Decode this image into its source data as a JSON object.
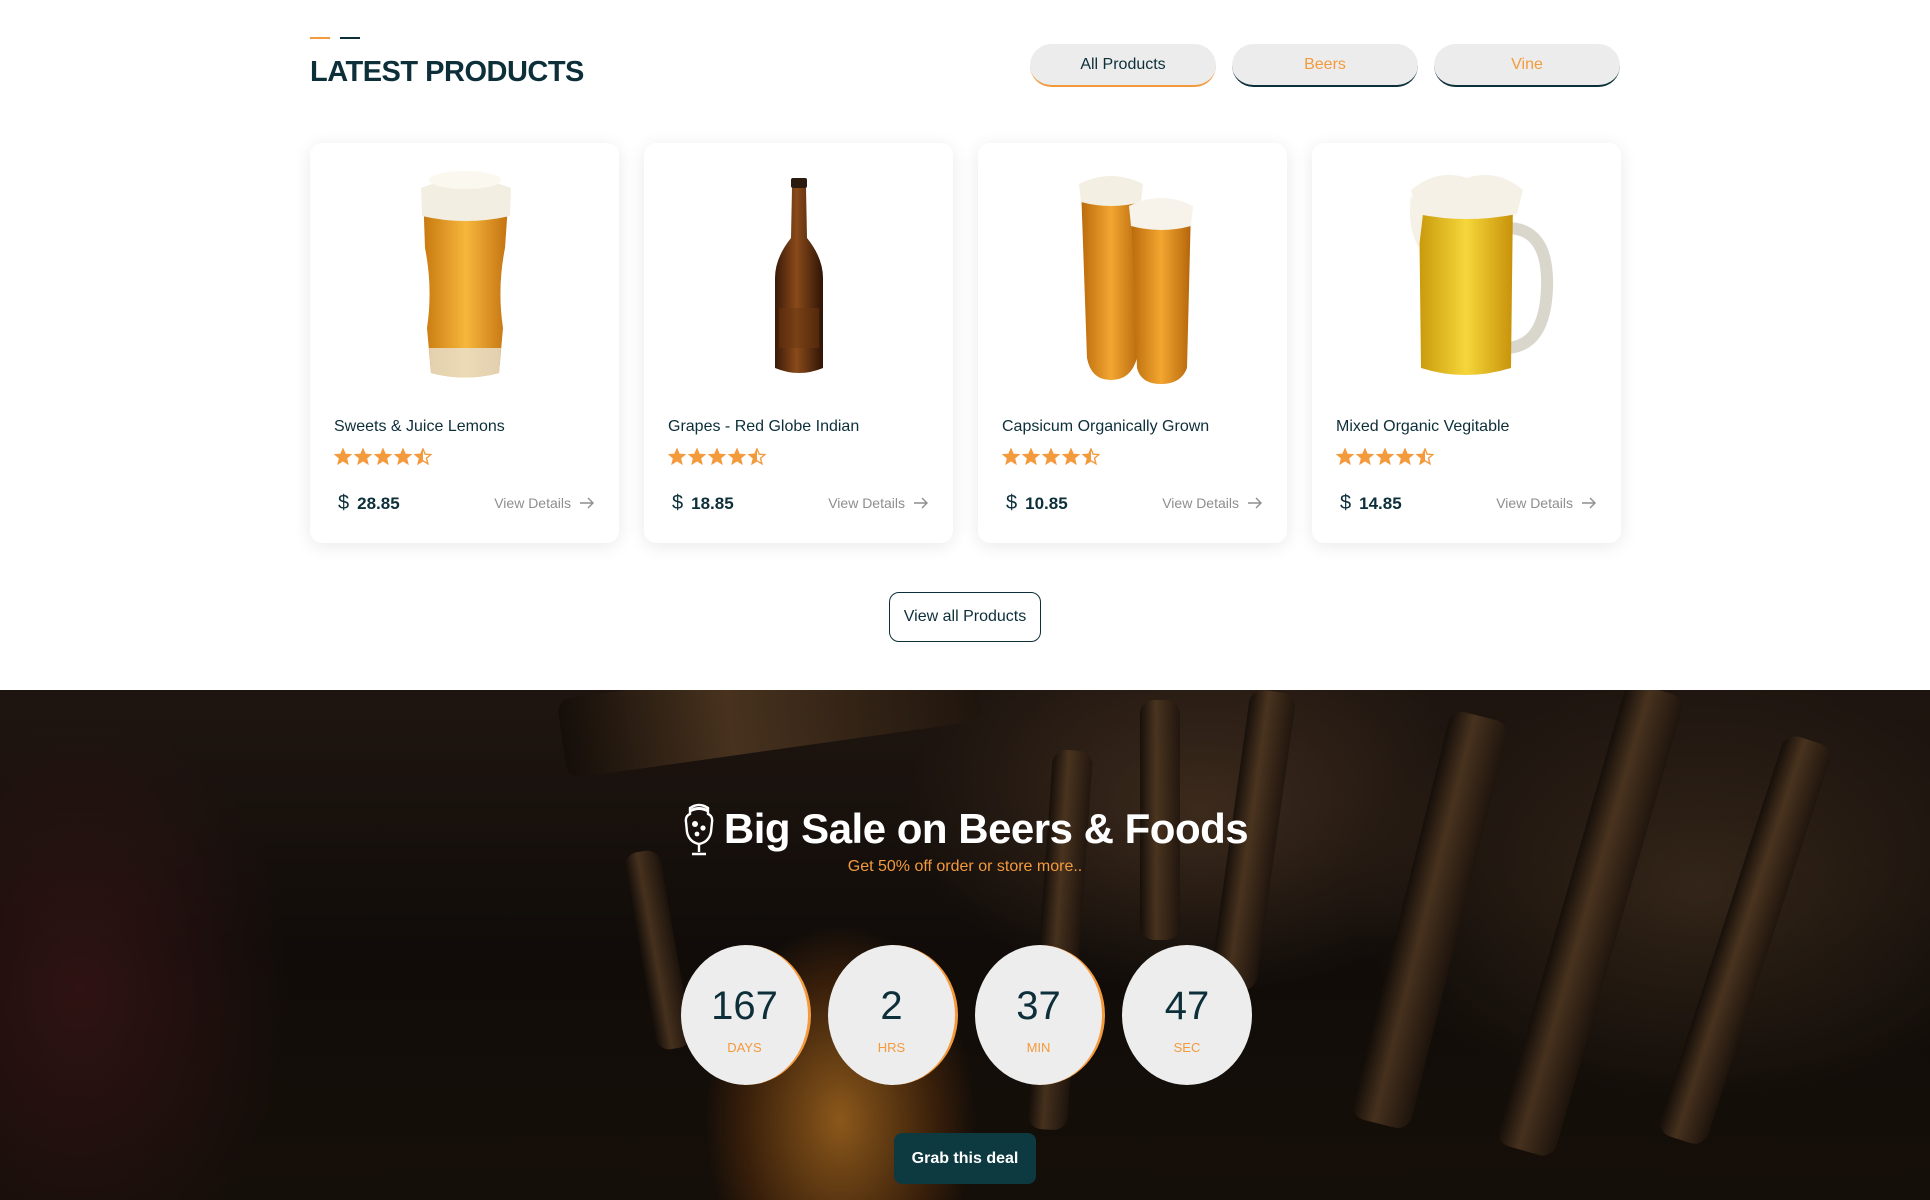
{
  "latest": {
    "title": "LATEST PRODUCTS",
    "filters": [
      {
        "label": "All Products",
        "active": true
      },
      {
        "label": "Beers",
        "active": false
      },
      {
        "label": "Vine",
        "active": false
      }
    ],
    "products": [
      {
        "name": "Sweets & Juice Lemons",
        "rating": 4.5,
        "currency": "$",
        "price": "28.85",
        "link": "View Details",
        "image": "pint-glass-icon"
      },
      {
        "name": "Grapes - Red Globe Indian",
        "rating": 4.5,
        "currency": "$",
        "price": "18.85",
        "link": "View Details",
        "image": "beer-bottle-icon"
      },
      {
        "name": "Capsicum Organically Grown",
        "rating": 4.5,
        "currency": "$",
        "price": "10.85",
        "link": "View Details",
        "image": "two-glasses-icon"
      },
      {
        "name": "Mixed Organic Vegitable",
        "rating": 4.5,
        "currency": "$",
        "price": "14.85",
        "link": "View Details",
        "image": "beer-mug-icon"
      }
    ],
    "view_all_label": "View all Products"
  },
  "sale": {
    "title": "Big Sale on Beers & Foods",
    "subtitle": "Get 50% off order or store more..",
    "countdown": [
      {
        "value": "167",
        "label": "DAYS"
      },
      {
        "value": "2",
        "label": "HRS"
      },
      {
        "value": "37",
        "label": "MIN"
      },
      {
        "value": "47",
        "label": "SEC"
      }
    ],
    "cta_label": "Grab this deal"
  },
  "colors": {
    "accent": "#f39a3d",
    "primary": "#0d2f3a",
    "button_dark": "#0d3a40"
  }
}
